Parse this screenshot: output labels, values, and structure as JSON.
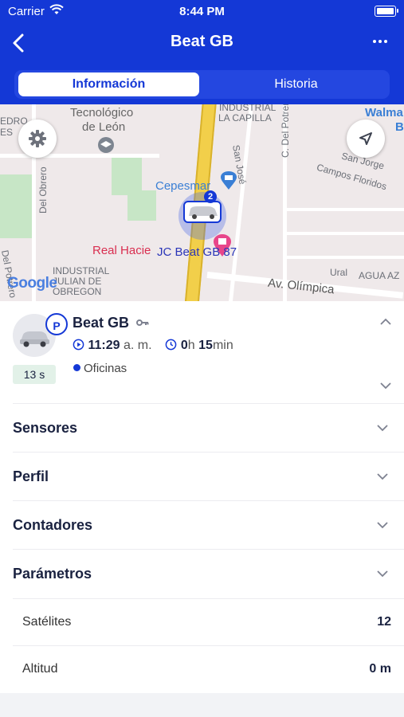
{
  "status_bar": {
    "carrier": "Carrier",
    "time": "8:44 PM"
  },
  "nav": {
    "title": "Beat GB"
  },
  "tabs": [
    {
      "label": "Información",
      "active": true
    },
    {
      "label": "Historia",
      "active": false
    }
  ],
  "map": {
    "labels": {
      "tec": "Tecnológico",
      "de_leon": "de León",
      "edro": "EDRO",
      "es": "ES",
      "industrial_capilla": "INDUSTRIAL",
      "la_capilla": "LA CAPILLA",
      "san_jose": "San José",
      "c_del_potrero": "C. Del Potrero",
      "walmart": "Walma",
      "b": "B",
      "san_jorge": "San Jorge",
      "campos_floridos": "Campos Floridos",
      "cepesmar": "Cepesmar",
      "real_hacienda": "Real Hacie",
      "del_obrero": "Del Obrero",
      "del_potrero": "Del Potrero",
      "industrial_julian": "INDUSTRIAL",
      "julian_de": "JULIAN DE",
      "obregon": "OBREGON",
      "av_olimpica": "Av. Olímpica",
      "ural": "Ural",
      "agua_az": "AGUA AZ",
      "vehicle_label": "JC Beat GB 87",
      "google": "Google"
    },
    "cluster_count": "2"
  },
  "vehicle": {
    "name": "Beat GB",
    "status_badge": "P",
    "duration_tag": "13 s",
    "time_value": "11:29",
    "time_suffix": "a. m.",
    "elapsed_hours": "0",
    "elapsed_h_unit": "h",
    "elapsed_minutes": "15",
    "elapsed_min_unit": "min",
    "location": "Oficinas"
  },
  "sections": [
    {
      "label": "Sensores"
    },
    {
      "label": "Perfil"
    },
    {
      "label": "Contadores"
    },
    {
      "label": "Parámetros"
    }
  ],
  "parameters": [
    {
      "label": "Satélites",
      "value": "12"
    },
    {
      "label": "Altitud",
      "value": "0 m"
    }
  ],
  "colors": {
    "primary": "#1438d6",
    "tag_bg": "#e2f1e8",
    "page_bg": "#f2f3f6"
  }
}
